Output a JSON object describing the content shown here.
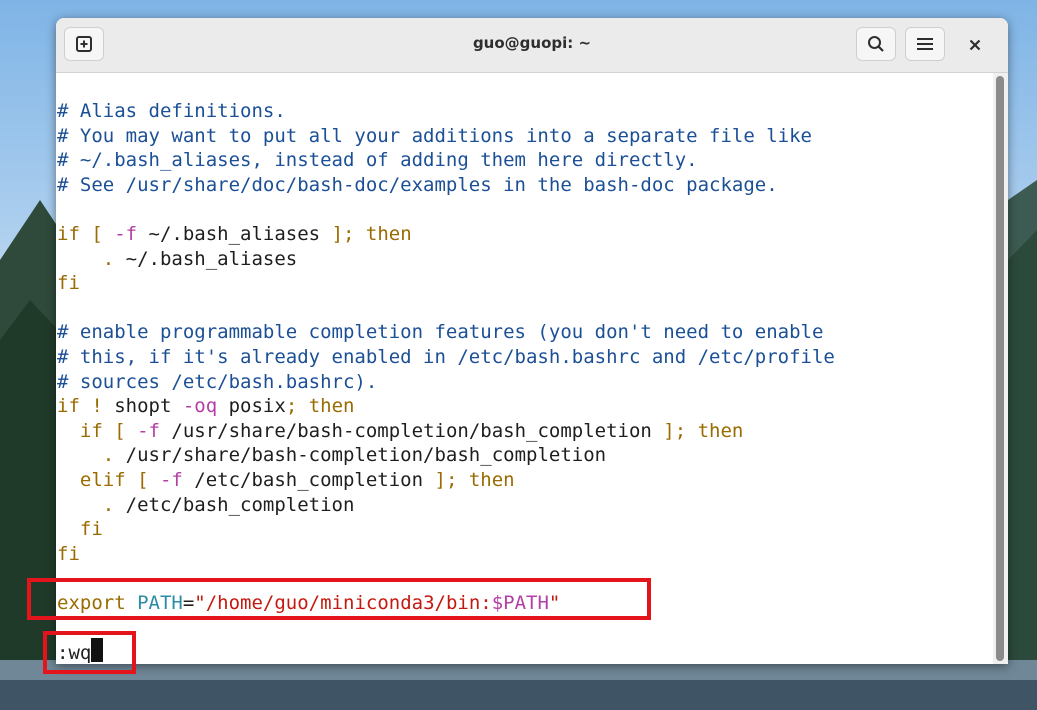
{
  "window": {
    "title": "guo@guopi: ~"
  },
  "icons": {
    "new_tab": "new-tab-icon",
    "search": "search-icon",
    "menu": "hamburger-menu-icon",
    "close": "close-icon"
  },
  "editor": {
    "lines": [
      {
        "segments": [
          {
            "text": "# Alias definitions.",
            "cls": "cm"
          }
        ]
      },
      {
        "segments": [
          {
            "text": "# You may want to put all your additions into a separate file like",
            "cls": "cm"
          }
        ]
      },
      {
        "segments": [
          {
            "text": "# ~/.bash_aliases, instead of adding them here directly.",
            "cls": "cm"
          }
        ]
      },
      {
        "segments": [
          {
            "text": "# See /usr/share/doc/bash-doc/examples in the bash-doc package.",
            "cls": "cm"
          }
        ]
      },
      {
        "segments": []
      },
      {
        "segments": [
          {
            "text": "if [ ",
            "cls": "kw"
          },
          {
            "text": "-f",
            "cls": "op"
          },
          {
            "text": " ~/.bash_aliases ",
            "cls": ""
          },
          {
            "text": "]; then",
            "cls": "kw"
          }
        ]
      },
      {
        "segments": [
          {
            "text": "    . ",
            "cls": "kw"
          },
          {
            "text": "~/.bash_aliases",
            "cls": ""
          }
        ]
      },
      {
        "segments": [
          {
            "text": "fi",
            "cls": "kw"
          }
        ]
      },
      {
        "segments": []
      },
      {
        "segments": [
          {
            "text": "# enable programmable completion features (you don't need to enable",
            "cls": "cm"
          }
        ]
      },
      {
        "segments": [
          {
            "text": "# this, if it's already enabled in /etc/bash.bashrc and /etc/profile",
            "cls": "cm"
          }
        ]
      },
      {
        "segments": [
          {
            "text": "# sources /etc/bash.bashrc).",
            "cls": "cm"
          }
        ]
      },
      {
        "segments": [
          {
            "text": "if ! ",
            "cls": "kw"
          },
          {
            "text": "shopt ",
            "cls": ""
          },
          {
            "text": "-oq",
            "cls": "op"
          },
          {
            "text": " posix",
            "cls": ""
          },
          {
            "text": "; then",
            "cls": "kw"
          }
        ]
      },
      {
        "segments": [
          {
            "text": "  if [ ",
            "cls": "kw"
          },
          {
            "text": "-f",
            "cls": "op"
          },
          {
            "text": " /usr/share/bash-completion/bash_completion ",
            "cls": ""
          },
          {
            "text": "]; then",
            "cls": "kw"
          }
        ]
      },
      {
        "segments": [
          {
            "text": "    . ",
            "cls": "kw"
          },
          {
            "text": "/usr/share/bash-completion/bash_completion",
            "cls": ""
          }
        ]
      },
      {
        "segments": [
          {
            "text": "  elif [ ",
            "cls": "kw"
          },
          {
            "text": "-f",
            "cls": "op"
          },
          {
            "text": " /etc/bash_completion ",
            "cls": ""
          },
          {
            "text": "]; then",
            "cls": "kw"
          }
        ]
      },
      {
        "segments": [
          {
            "text": "    . ",
            "cls": "kw"
          },
          {
            "text": "/etc/bash_completion",
            "cls": ""
          }
        ]
      },
      {
        "segments": [
          {
            "text": "  fi",
            "cls": "kw"
          }
        ]
      },
      {
        "segments": [
          {
            "text": "fi",
            "cls": "kw"
          }
        ]
      },
      {
        "segments": []
      },
      {
        "segments": [
          {
            "text": "export ",
            "cls": "kw"
          },
          {
            "text": "PATH",
            "cls": "var"
          },
          {
            "text": "=",
            "cls": ""
          },
          {
            "text": "\"/home/guo/miniconda3/bin:",
            "cls": "str"
          },
          {
            "text": "$PATH",
            "cls": "var2"
          },
          {
            "text": "\"",
            "cls": "str"
          }
        ]
      }
    ],
    "command_line": ":wq"
  }
}
